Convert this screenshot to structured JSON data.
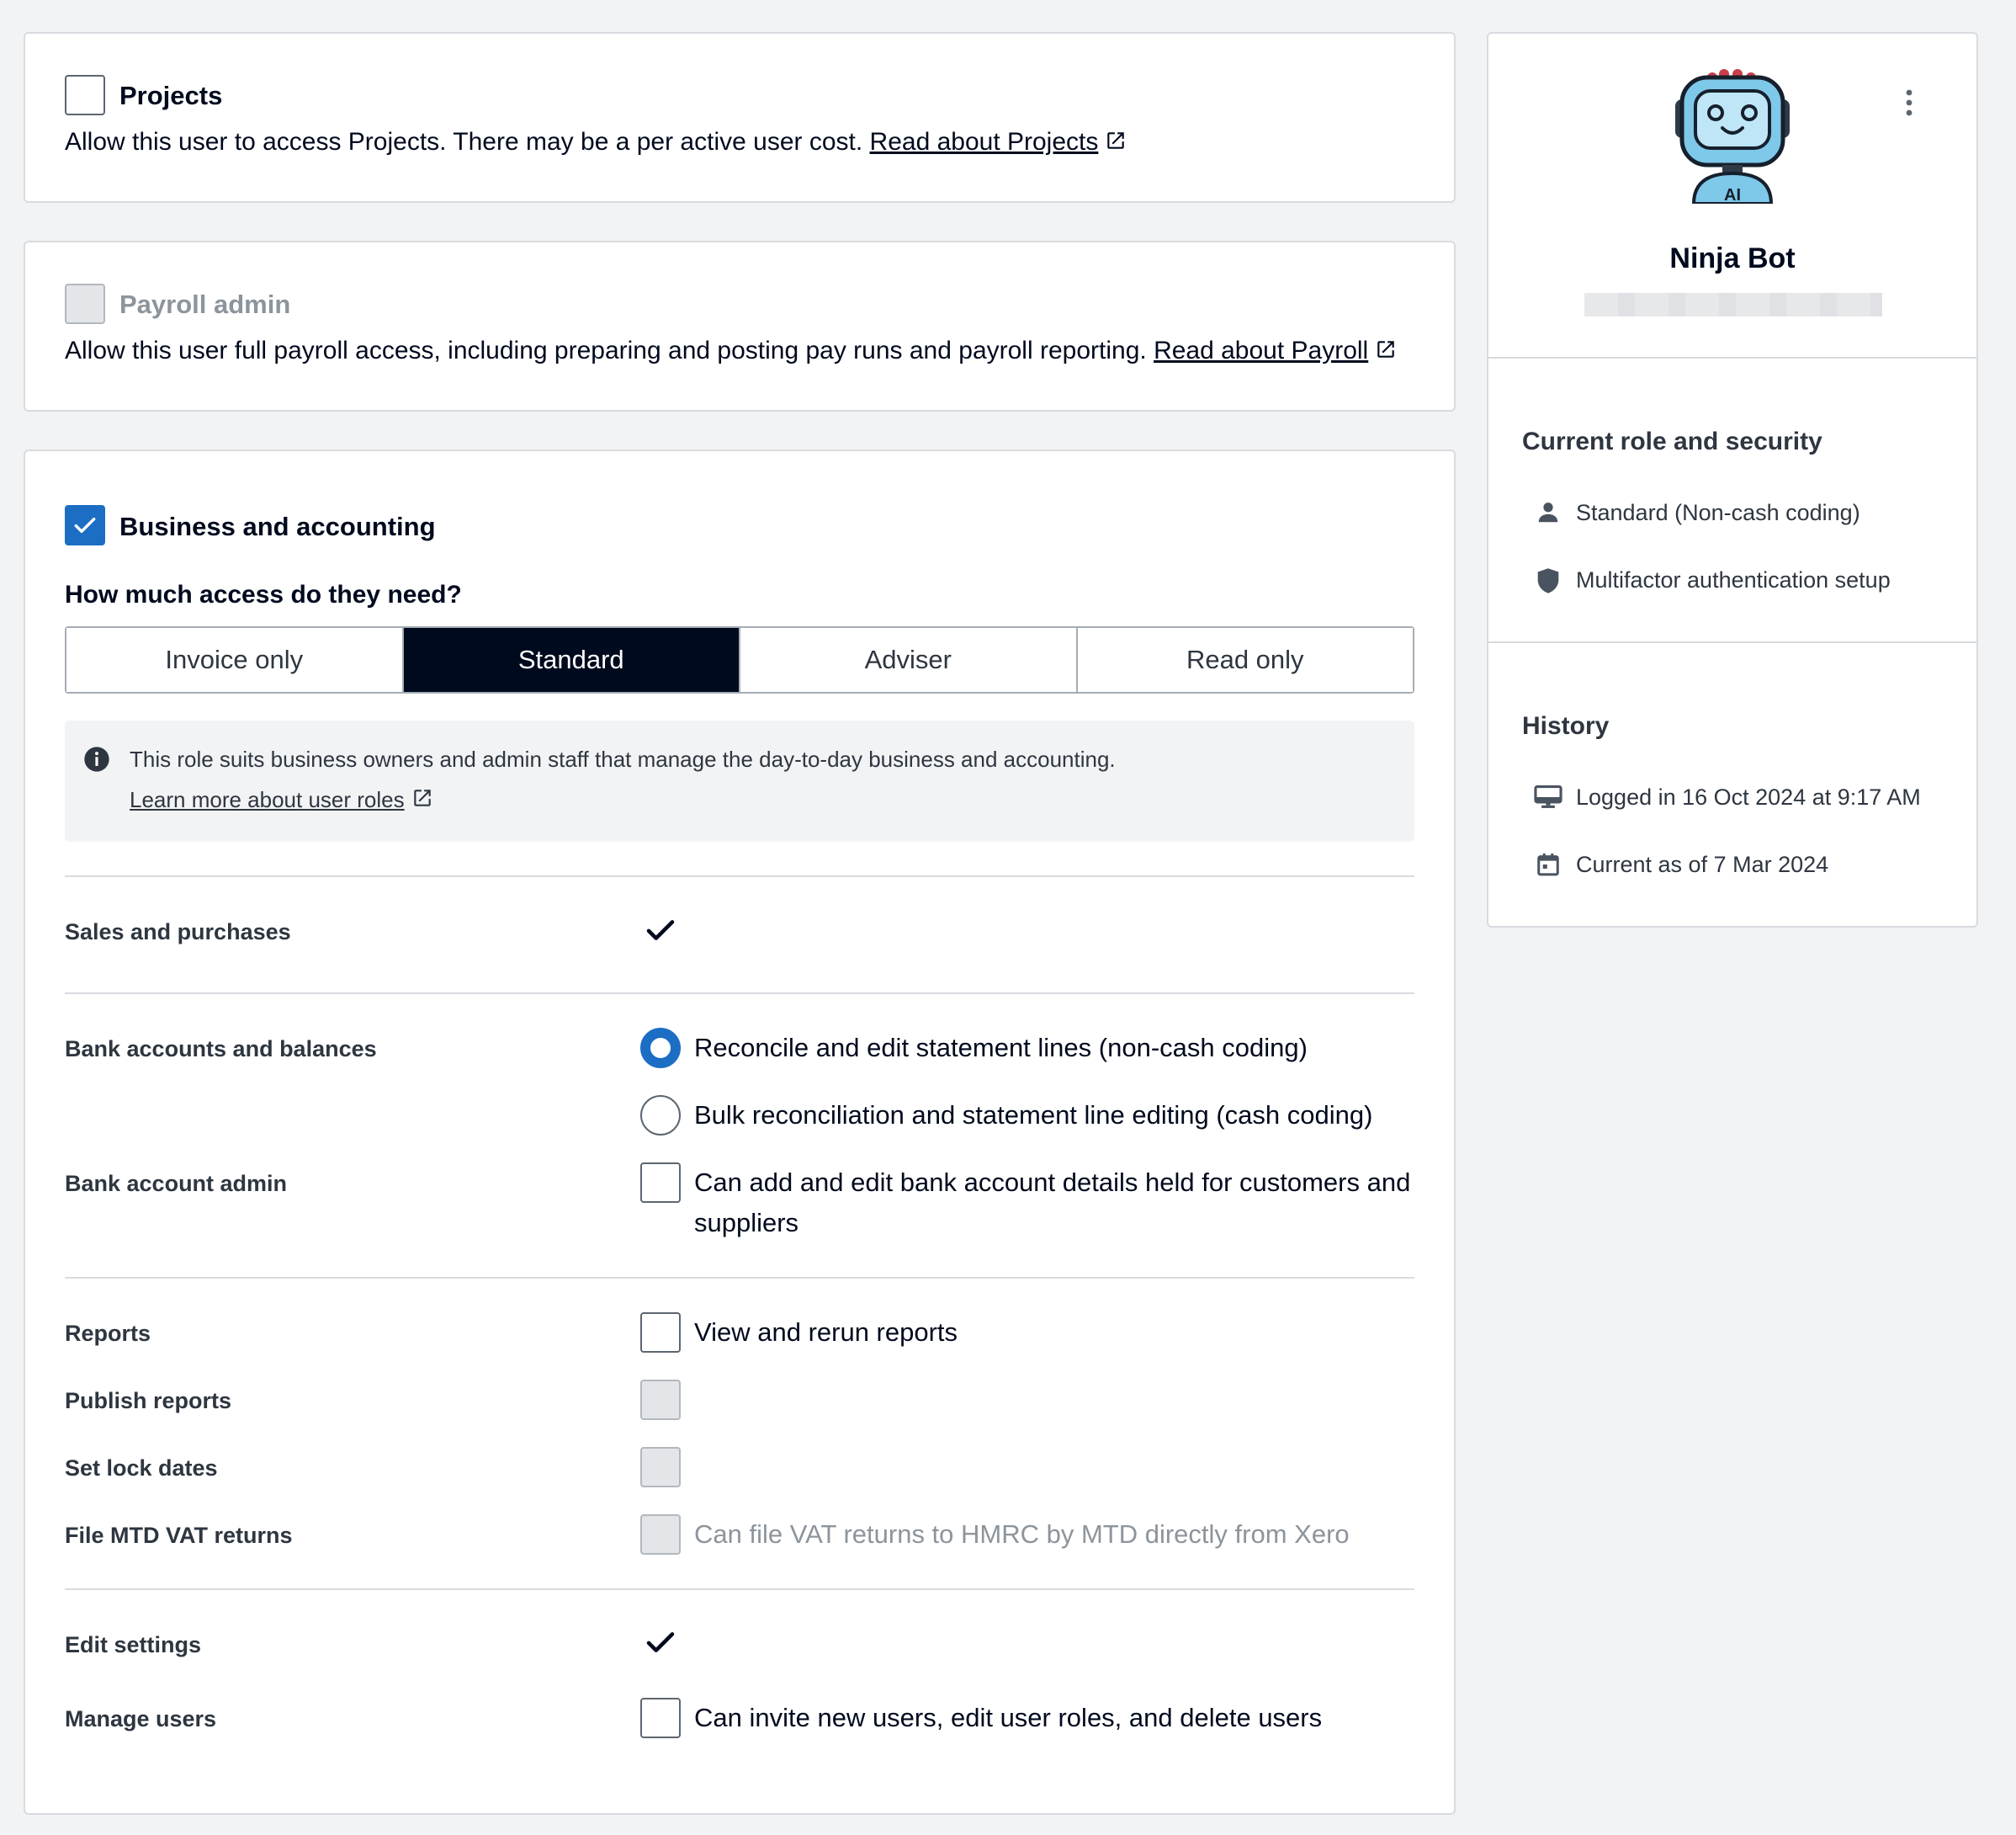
{
  "projects": {
    "title": "Projects",
    "description": "Allow this user to access Projects. There may be a per active user cost.",
    "link": "Read about Projects"
  },
  "payroll": {
    "title": "Payroll admin",
    "description": "Allow this user full payroll access, including preparing and posting pay runs and payroll reporting.",
    "link": "Read about Payroll"
  },
  "business": {
    "title": "Business and accounting",
    "question": "How much access do they need?",
    "access_levels": [
      "Invoice only",
      "Standard",
      "Adviser",
      "Read only"
    ],
    "selected_access": "Standard",
    "info_text": "This role suits business owners and admin staff that manage the day-to-day business and accounting.",
    "info_link": "Learn more about user roles",
    "permissions": {
      "sales": "Sales and purchases",
      "bank_accounts": "Bank accounts and balances",
      "bank_option_1": "Reconcile and edit statement lines (non-cash coding)",
      "bank_option_2": "Bulk reconciliation and statement line editing (cash coding)",
      "bank_admin": "Bank account admin",
      "bank_admin_option_line1": "Can add and edit bank account details held for customers and",
      "bank_admin_option_line2": "suppliers",
      "reports": "Reports",
      "reports_option": "View and rerun reports",
      "publish_reports": "Publish reports",
      "lock_dates": "Set lock dates",
      "mtd_vat": "File MTD VAT returns",
      "mtd_vat_option": "Can file VAT returns to HMRC by MTD directly from Xero",
      "edit_settings": "Edit settings",
      "manage_users": "Manage users",
      "manage_users_option": "Can invite new users, edit user roles, and delete users"
    }
  },
  "profile": {
    "name": "Ninja Bot",
    "avatar_badge": "AI",
    "role_heading": "Current role and security",
    "role": "Standard (Non-cash coding)",
    "mfa": "Multifactor authentication setup",
    "history_heading": "History",
    "last_login": "Logged in 16 Oct 2024 at 9:17 AM",
    "current_as_of": "Current as of 7 Mar 2024"
  },
  "colors": {
    "accent": "#1c6ec4",
    "dark": "#000a1e",
    "background": "#f2f3f4"
  }
}
